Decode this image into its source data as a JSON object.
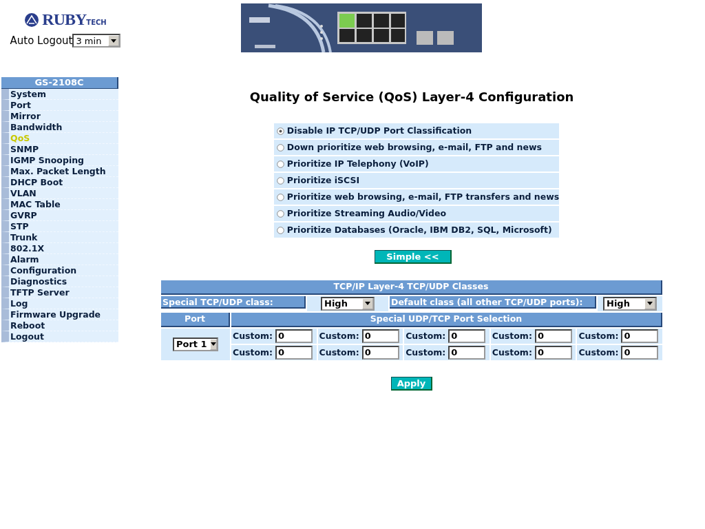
{
  "header": {
    "logo_text": "RUBY",
    "logo_suffix": "TECH",
    "auto_logout": {
      "label": "Auto Logout",
      "value": "3 min"
    }
  },
  "sidebar": {
    "title": "GS-2108C",
    "items": [
      {
        "label": "System",
        "selected": false
      },
      {
        "label": "Port",
        "selected": false
      },
      {
        "label": "Mirror",
        "selected": false
      },
      {
        "label": "Bandwidth",
        "selected": false
      },
      {
        "label": "QoS",
        "selected": true
      },
      {
        "label": "SNMP",
        "selected": false
      },
      {
        "label": "IGMP Snooping",
        "selected": false
      },
      {
        "label": "Max. Packet Length",
        "selected": false
      },
      {
        "label": "DHCP Boot",
        "selected": false
      },
      {
        "label": "VLAN",
        "selected": false
      },
      {
        "label": "MAC Table",
        "selected": false
      },
      {
        "label": "GVRP",
        "selected": false
      },
      {
        "label": "STP",
        "selected": false
      },
      {
        "label": "Trunk",
        "selected": false
      },
      {
        "label": "802.1X",
        "selected": false
      },
      {
        "label": "Alarm",
        "selected": false
      },
      {
        "label": "Configuration",
        "selected": false
      },
      {
        "label": "Diagnostics",
        "selected": false
      },
      {
        "label": "TFTP Server",
        "selected": false
      },
      {
        "label": "Log",
        "selected": false
      },
      {
        "label": "Firmware Upgrade",
        "selected": false
      },
      {
        "label": "Reboot",
        "selected": false
      },
      {
        "label": "Logout",
        "selected": false
      }
    ]
  },
  "title": "Quality of Service (QoS) Layer-4 Configuration",
  "options": [
    {
      "label": "Disable IP TCP/UDP Port Classification",
      "selected": true
    },
    {
      "label": "Down prioritize web browsing, e-mail, FTP and news",
      "selected": false
    },
    {
      "label": "Prioritize IP Telephony (VoIP)",
      "selected": false
    },
    {
      "label": "Prioritize iSCSI",
      "selected": false
    },
    {
      "label": "Prioritize web browsing, e-mail, FTP transfers and news",
      "selected": false
    },
    {
      "label": "Prioritize Streaming Audio/Video",
      "selected": false
    },
    {
      "label": "Prioritize Databases (Oracle, IBM DB2, SQL, Microsoft)",
      "selected": false
    }
  ],
  "toggle_button": "Simple <<",
  "classes_table": {
    "title": "TCP/IP Layer-4 TCP/UDP Classes",
    "special_label": "Special TCP/UDP class:",
    "special_value": "High",
    "default_label": "Default class (all other TCP/UDP ports):",
    "default_value": "High",
    "port_header": "Port",
    "selection_header": "Special UDP/TCP Port Selection",
    "port_value": "Port 1",
    "custom_rows": [
      [
        {
          "label": "Custom:",
          "value": "0"
        },
        {
          "label": "Custom:",
          "value": "0"
        },
        {
          "label": "Custom:",
          "value": "0"
        },
        {
          "label": "Custom:",
          "value": "0"
        },
        {
          "label": "Custom:",
          "value": "0"
        }
      ],
      [
        {
          "label": "Custom:",
          "value": "0"
        },
        {
          "label": "Custom:",
          "value": "0"
        },
        {
          "label": "Custom:",
          "value": "0"
        },
        {
          "label": "Custom:",
          "value": "0"
        },
        {
          "label": "Custom:",
          "value": "0"
        }
      ]
    ]
  },
  "apply_button": "Apply"
}
